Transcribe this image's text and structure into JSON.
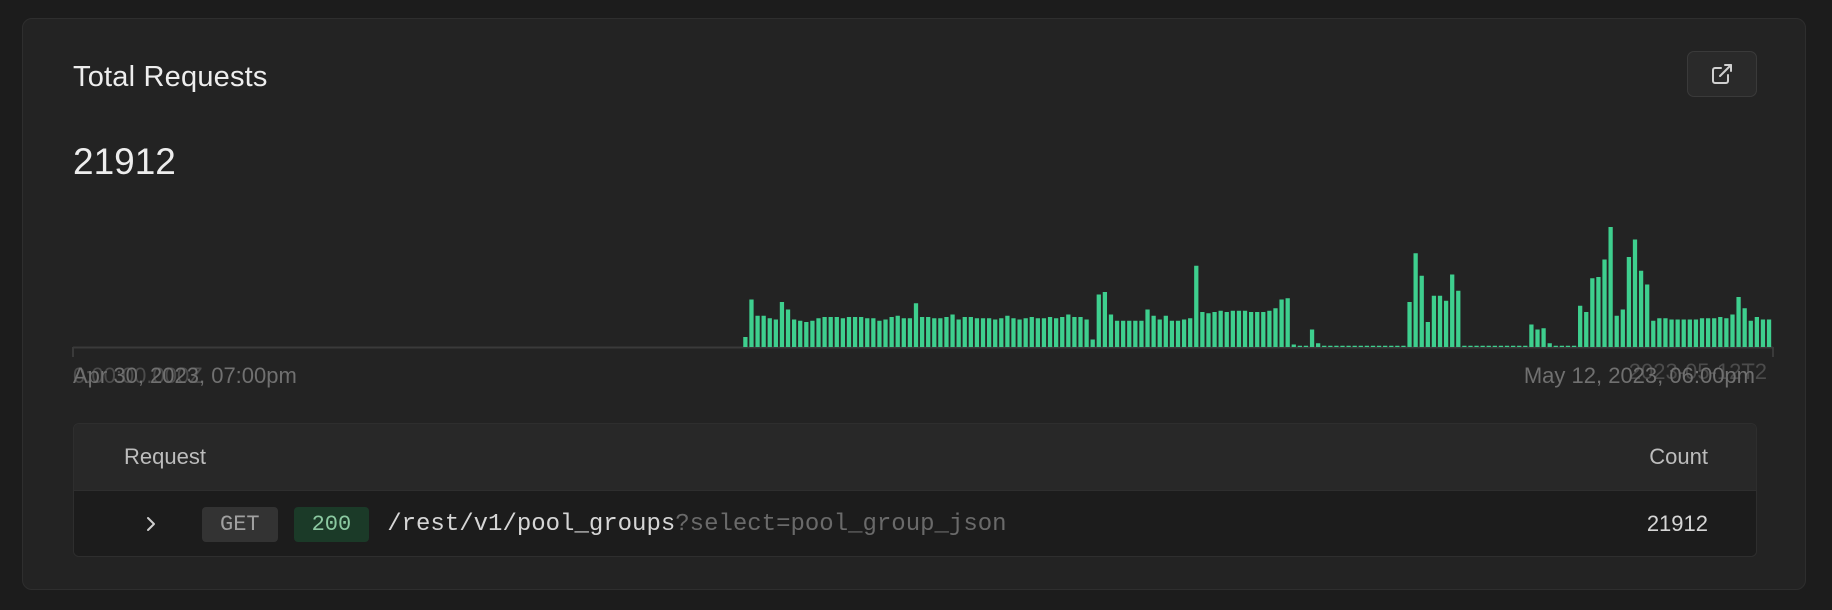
{
  "card": {
    "title": "Total Requests",
    "total": "21912",
    "open_button_icon": "external-link-icon"
  },
  "axis": {
    "start_label": "Apr 30, 2023, 07:00pm",
    "end_label": "May 12, 2023, 06:00pm",
    "start_ghost": "0:00:00.000Z",
    "end_ghost": "2023-05-12T2"
  },
  "colors": {
    "bar": "#3ecf8e",
    "axis": "#3a3a3a",
    "method_bg": "#333333",
    "status_bg": "#1b3a28"
  },
  "table": {
    "header_request": "Request",
    "header_count": "Count",
    "rows": [
      {
        "method": "GET",
        "status": "200",
        "path": "/rest/v1/pool_groups",
        "query": "?select=pool_group_json",
        "count": "21912"
      }
    ]
  },
  "chart_data": {
    "type": "bar",
    "x_start": "Apr 30, 2023, 07:00pm",
    "x_end": "May 12, 2023, 06:00pm",
    "values": [
      0,
      0,
      0,
      0,
      0,
      0,
      0,
      0,
      0,
      0,
      0,
      0,
      0,
      0,
      0,
      0,
      0,
      0,
      0,
      0,
      0,
      0,
      0,
      0,
      0,
      0,
      0,
      0,
      0,
      0,
      0,
      0,
      0,
      0,
      0,
      0,
      0,
      0,
      0,
      0,
      0,
      0,
      0,
      0,
      0,
      0,
      0,
      0,
      0,
      0,
      0,
      0,
      0,
      0,
      0,
      0,
      0,
      0,
      0,
      0,
      0,
      0,
      0,
      0,
      0,
      0,
      0,
      0,
      0,
      0,
      0,
      0,
      0,
      0,
      0,
      0,
      0,
      0,
      0,
      0,
      0,
      0,
      0,
      0,
      0,
      0,
      0,
      0,
      0,
      0,
      0,
      0,
      0,
      0,
      0,
      0,
      0,
      0,
      0,
      0,
      0,
      0,
      0,
      0,
      0,
      0,
      0,
      0,
      0,
      0,
      8,
      38,
      25,
      25,
      23,
      22,
      36,
      30,
      22,
      21,
      20,
      21,
      23,
      24,
      24,
      24,
      23,
      24,
      24,
      24,
      23,
      23,
      21,
      22,
      24,
      25,
      23,
      23,
      35,
      24,
      24,
      23,
      23,
      24,
      26,
      22,
      24,
      24,
      23,
      23,
      23,
      22,
      23,
      25,
      23,
      22,
      23,
      24,
      23,
      23,
      24,
      23,
      24,
      26,
      24,
      24,
      22,
      6,
      42,
      44,
      26,
      21,
      21,
      21,
      21,
      21,
      30,
      25,
      22,
      25,
      21,
      21,
      22,
      23,
      65,
      28,
      27,
      28,
      29,
      28,
      29,
      29,
      29,
      28,
      28,
      28,
      29,
      31,
      38,
      39,
      2,
      1,
      1,
      14,
      3,
      1,
      1,
      1,
      1,
      1,
      1,
      1,
      1,
      1,
      1,
      1,
      1,
      1,
      1,
      36,
      75,
      57,
      20,
      41,
      41,
      37,
      58,
      45,
      1,
      1,
      1,
      1,
      1,
      1,
      1,
      1,
      1,
      1,
      1,
      18,
      14,
      15,
      3,
      1,
      1,
      1,
      1,
      33,
      28,
      55,
      56,
      70,
      96,
      25,
      30,
      72,
      86,
      61,
      50,
      21,
      23,
      23,
      22,
      22,
      22,
      22,
      22,
      23,
      23,
      23,
      24,
      23,
      26,
      40,
      31,
      21,
      24,
      22,
      22
    ]
  }
}
